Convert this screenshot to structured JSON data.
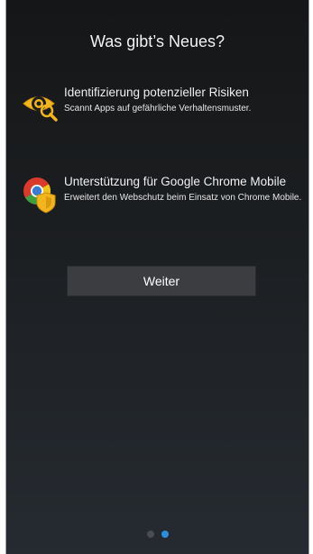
{
  "page": {
    "title": "Was gibt’s Neues?"
  },
  "features": [
    {
      "icon": "eye-magnifier-icon",
      "title": "Identifizierung potenzieller Risiken",
      "description": "Scannt Apps auf gefährliche Verhaltensmuster."
    },
    {
      "icon": "chrome-shield-icon",
      "title": "Unterstützung für Google Chrome Mobile",
      "description": "Erweitert den Webschutz beim Einsatz von Chrome Mobile."
    }
  ],
  "continue_button": {
    "label": "Weiter"
  },
  "pager": {
    "total": 2,
    "active": 2
  },
  "colors": {
    "accent_dot": "#2b8fe0",
    "icon_yellow": "#f2b51c"
  }
}
